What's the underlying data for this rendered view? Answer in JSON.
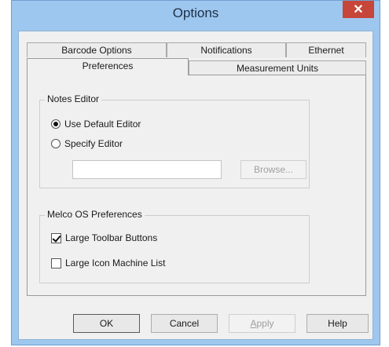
{
  "window": {
    "title": "Options",
    "close_glyph": "✕"
  },
  "tabs": {
    "row_back": [
      {
        "label": "Barcode Options"
      },
      {
        "label": "Notifications"
      },
      {
        "label": "Ethernet"
      }
    ],
    "row_front": [
      {
        "label": "Preferences",
        "active": true
      },
      {
        "label": "Measurement Units",
        "active": false
      }
    ]
  },
  "notes_editor": {
    "legend": "Notes Editor",
    "use_default_label": "Use Default Editor",
    "use_default_selected": true,
    "specify_label": "Specify Editor",
    "specify_selected": false,
    "path_value": "",
    "browse_label": "Browse..."
  },
  "melco_prefs": {
    "legend": "Melco OS Preferences",
    "large_toolbar_label": "Large Toolbar Buttons",
    "large_toolbar_checked": true,
    "large_icon_label": "Large Icon Machine List",
    "large_icon_checked": false
  },
  "buttons": {
    "ok": "OK",
    "cancel": "Cancel",
    "apply_first": "A",
    "apply_rest": "pply",
    "help": "Help"
  }
}
